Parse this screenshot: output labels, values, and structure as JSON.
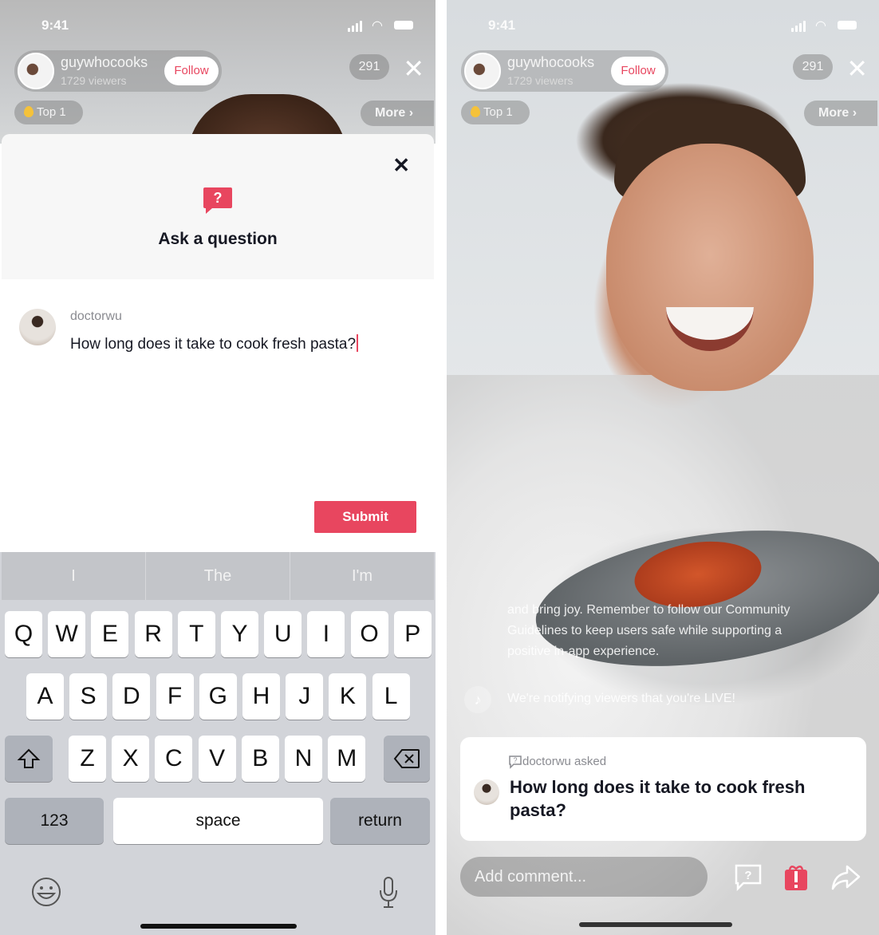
{
  "status_bar": {
    "time": "9:41"
  },
  "live_header": {
    "host_name": "guywhocooks",
    "viewers": "1729 viewers",
    "follow_label": "Follow",
    "gift_count": "291",
    "top_rank": "Top 1",
    "more_label": "More",
    "more_chevron": "›"
  },
  "question_sheet": {
    "title": "Ask a question",
    "close_icon": "✕",
    "user": "doctorwu",
    "question_text": "How long does it take to cook fresh pasta?",
    "submit_label": "Submit"
  },
  "keyboard": {
    "suggestions": [
      "I",
      "The",
      "I'm"
    ],
    "row1": [
      "Q",
      "W",
      "E",
      "R",
      "T",
      "Y",
      "U",
      "I",
      "O",
      "P"
    ],
    "row2": [
      "A",
      "S",
      "D",
      "F",
      "G",
      "H",
      "J",
      "K",
      "L"
    ],
    "row3": [
      "Z",
      "X",
      "C",
      "V",
      "B",
      "N",
      "M"
    ],
    "numbers_label": "123",
    "space_label": "space",
    "return_label": "return"
  },
  "live_view": {
    "chat_lines": [
      "and bring joy. Remember to follow our Community",
      "Guidelines to keep users safe while supporting a",
      "positive in-app experience."
    ],
    "notify_message": "We're notifying viewers that you're LIVE!",
    "question_card": {
      "meta": "doctorwu asked",
      "question": "How long does it take to cook fresh pasta?"
    },
    "comment_placeholder": "Add comment..."
  },
  "colors": {
    "accent": "#e8465f",
    "text_dark": "#161823",
    "keyboard_bg": "#d2d4d9"
  }
}
